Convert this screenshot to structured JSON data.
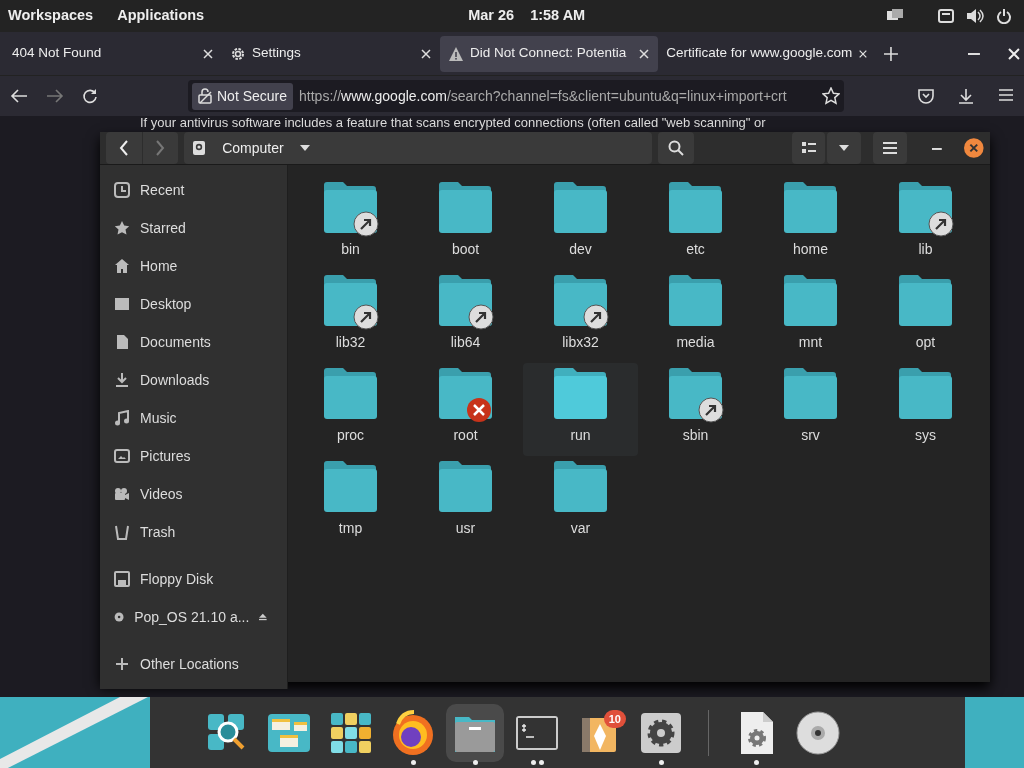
{
  "top_bar": {
    "workspaces": "Workspaces",
    "applications": "Applications",
    "date": "Mar 26",
    "time": "1:58 AM"
  },
  "browser": {
    "tabs": [
      {
        "title": "404 Not Found",
        "selected": false
      },
      {
        "title": "Settings",
        "selected": false
      },
      {
        "title": "Did Not Connect: Potentia",
        "selected": true
      },
      {
        "title": "Certificate for www.google.com",
        "selected": false
      }
    ],
    "security_label": "Not Secure",
    "url": {
      "scheme": "https://",
      "host": "www.google.com",
      "path": "/search?channel=fs&client=ubuntu&q=linux+import+crt"
    },
    "page_text": "If your antivirus software includes a feature that scans encrypted connections (often called \"web scanning\" or"
  },
  "file_manager": {
    "location": "Computer",
    "back_disabled": false,
    "forward_disabled": true,
    "sidebar": [
      {
        "items": [
          {
            "label": "Recent",
            "ejectable": false
          },
          {
            "label": "Starred",
            "ejectable": false
          },
          {
            "label": "Home",
            "ejectable": false
          },
          {
            "label": "Desktop",
            "ejectable": false
          },
          {
            "label": "Documents",
            "ejectable": false
          },
          {
            "label": "Downloads",
            "ejectable": false
          },
          {
            "label": "Music",
            "ejectable": false
          },
          {
            "label": "Pictures",
            "ejectable": false
          },
          {
            "label": "Videos",
            "ejectable": false
          },
          {
            "label": "Trash",
            "ejectable": false
          }
        ]
      },
      {
        "items": [
          {
            "label": "Floppy Disk",
            "ejectable": false
          },
          {
            "label": "Pop_OS 21.10 a...",
            "ejectable": true
          }
        ]
      },
      {
        "items": [
          {
            "label": "Other Locations",
            "ejectable": false
          }
        ]
      }
    ],
    "folders": [
      {
        "name": "bin",
        "kind": "link",
        "hovered": false
      },
      {
        "name": "boot",
        "kind": "plain",
        "hovered": false
      },
      {
        "name": "dev",
        "kind": "plain",
        "hovered": false
      },
      {
        "name": "etc",
        "kind": "plain",
        "hovered": false
      },
      {
        "name": "home",
        "kind": "plain",
        "hovered": false
      },
      {
        "name": "lib",
        "kind": "link",
        "hovered": false
      },
      {
        "name": "lib32",
        "kind": "link",
        "hovered": false
      },
      {
        "name": "lib64",
        "kind": "link",
        "hovered": false
      },
      {
        "name": "libx32",
        "kind": "link",
        "hovered": false
      },
      {
        "name": "media",
        "kind": "plain",
        "hovered": false
      },
      {
        "name": "mnt",
        "kind": "plain",
        "hovered": false
      },
      {
        "name": "opt",
        "kind": "plain",
        "hovered": false
      },
      {
        "name": "proc",
        "kind": "plain",
        "hovered": false
      },
      {
        "name": "root",
        "kind": "locked",
        "hovered": false
      },
      {
        "name": "run",
        "kind": "plain",
        "hovered": true
      },
      {
        "name": "sbin",
        "kind": "link",
        "hovered": false
      },
      {
        "name": "srv",
        "kind": "plain",
        "hovered": false
      },
      {
        "name": "sys",
        "kind": "plain",
        "hovered": false
      },
      {
        "name": "tmp",
        "kind": "plain",
        "hovered": false
      },
      {
        "name": "usr",
        "kind": "plain",
        "hovered": false
      },
      {
        "name": "var",
        "kind": "plain",
        "hovered": false
      }
    ]
  },
  "dock": {
    "items": [
      {
        "kind": "search",
        "running": false,
        "multiple_windows": false,
        "selected": false
      },
      {
        "kind": "workspaces",
        "running": false,
        "multiple_windows": false,
        "selected": false
      },
      {
        "kind": "apps",
        "running": false,
        "multiple_windows": false,
        "selected": false
      },
      {
        "kind": "firefox",
        "running": true,
        "multiple_windows": false,
        "selected": false
      },
      {
        "kind": "files",
        "running": true,
        "multiple_windows": false,
        "selected": true
      },
      {
        "kind": "terminal",
        "running": true,
        "multiple_windows": true,
        "selected": false
      },
      {
        "kind": "shop",
        "running": false,
        "multiple_windows": false,
        "selected": false,
        "badge": "10"
      },
      {
        "kind": "settings",
        "running": true,
        "multiple_windows": false,
        "selected": false
      },
      {
        "kind": "separator"
      },
      {
        "kind": "document",
        "running": true,
        "multiple_windows": false,
        "selected": false
      },
      {
        "kind": "disc",
        "running": false,
        "multiple_windows": false,
        "selected": false
      }
    ]
  }
}
